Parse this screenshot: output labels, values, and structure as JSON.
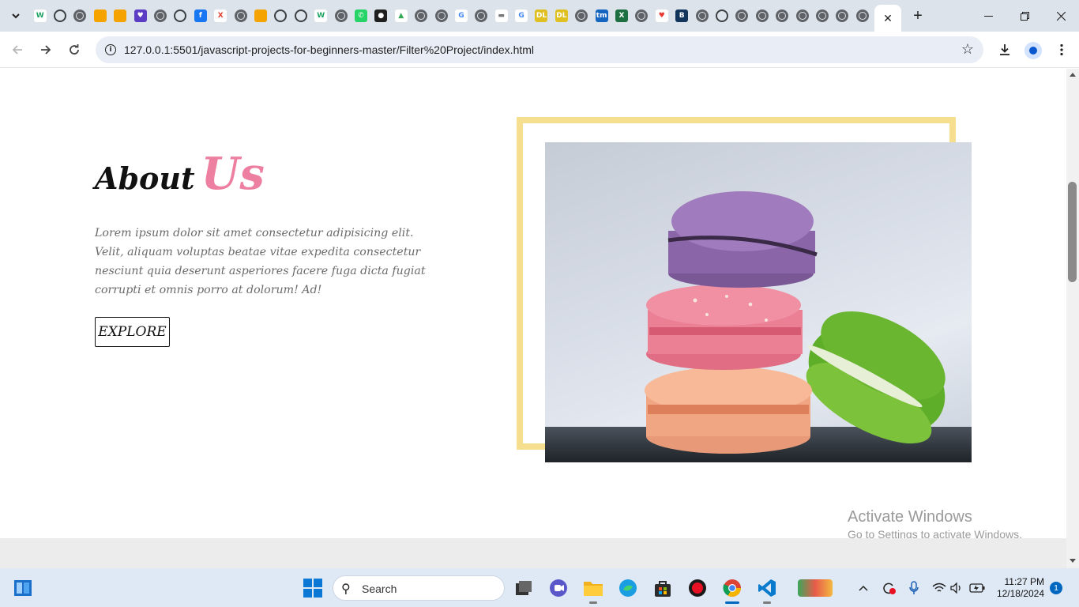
{
  "browser": {
    "active_tab_close": "✕",
    "new_tab": "+",
    "url": "127.0.0.1:5501/javascript-projects-for-beginners-master/Filter%20Project/index.html",
    "tab_favicons": [
      {
        "icon": "w-icon",
        "label": "W",
        "bg": "#ffffff",
        "fg": "#1aa260"
      },
      {
        "icon": "openai-icon",
        "label": "",
        "kind": "ring"
      },
      {
        "icon": "globe-icon",
        "label": "",
        "kind": "globe"
      },
      {
        "icon": "warning-icon",
        "label": "",
        "bg": "#f4a300"
      },
      {
        "icon": "warning-icon",
        "label": "",
        "bg": "#f4a300"
      },
      {
        "icon": "heart-badge-icon",
        "label": "♥",
        "bg": "#5b3cc4"
      },
      {
        "icon": "globe-icon",
        "label": "",
        "kind": "globe"
      },
      {
        "icon": "openai-icon",
        "label": "",
        "kind": "ring"
      },
      {
        "icon": "facebook-icon",
        "label": "f",
        "bg": "#1877f2"
      },
      {
        "icon": "x-icon",
        "label": "X",
        "bg": "#ffffff",
        "fg": "#e03e2d"
      },
      {
        "icon": "globe-icon",
        "label": "",
        "kind": "globe"
      },
      {
        "icon": "warning-icon",
        "label": "",
        "bg": "#f4a300"
      },
      {
        "icon": "openai-icon",
        "label": "",
        "kind": "ring"
      },
      {
        "icon": "chrome-icon",
        "label": "",
        "kind": "ring"
      },
      {
        "icon": "w-icon",
        "label": "W",
        "bg": "#ffffff",
        "fg": "#1aa260"
      },
      {
        "icon": "globe-icon",
        "label": "",
        "kind": "globe"
      },
      {
        "icon": "whatsapp-icon",
        "label": "✆",
        "bg": "#25d366"
      },
      {
        "icon": "github-icon",
        "label": "●",
        "bg": "#1f1f1f"
      },
      {
        "icon": "drive-icon",
        "label": "▲",
        "bg": "#ffffff",
        "fg": "#34a853"
      },
      {
        "icon": "globe-icon",
        "label": "",
        "kind": "globe"
      },
      {
        "icon": "globe-icon",
        "label": "",
        "kind": "globe"
      },
      {
        "icon": "google-icon",
        "label": "G",
        "bg": "#ffffff",
        "fg": "#4285f4"
      },
      {
        "icon": "globe-icon",
        "label": "",
        "kind": "globe"
      },
      {
        "icon": "page-icon",
        "label": "▬",
        "bg": "#ffffff",
        "fg": "#777777"
      },
      {
        "icon": "google-icon",
        "label": "G",
        "bg": "#ffffff",
        "fg": "#4285f4"
      },
      {
        "icon": "dxl-icon",
        "label": "DL",
        "bg": "#e0c020"
      },
      {
        "icon": "dxl-icon",
        "label": "DL",
        "bg": "#e0c020"
      },
      {
        "icon": "globe-icon",
        "label": "",
        "kind": "globe"
      },
      {
        "icon": "tm-icon",
        "label": "tm",
        "bg": "#1565c0"
      },
      {
        "icon": "excel-icon",
        "label": "X",
        "bg": "#1d6f42"
      },
      {
        "icon": "globe-icon",
        "label": "",
        "kind": "globe"
      },
      {
        "icon": "heart-icon",
        "label": "♥",
        "bg": "#ffffff",
        "fg": "#e53935"
      },
      {
        "icon": "bond-icon",
        "label": "B",
        "bg": "#12355b"
      },
      {
        "icon": "globe-icon",
        "label": "",
        "kind": "globe"
      },
      {
        "icon": "chrome-icon",
        "label": "",
        "kind": "ring"
      },
      {
        "icon": "globe-icon",
        "label": "",
        "kind": "globe"
      },
      {
        "icon": "globe-icon",
        "label": "",
        "kind": "globe"
      },
      {
        "icon": "globe-icon",
        "label": "",
        "kind": "globe"
      },
      {
        "icon": "globe-icon",
        "label": "",
        "kind": "globe"
      },
      {
        "icon": "globe-icon",
        "label": "",
        "kind": "globe"
      },
      {
        "icon": "globe-icon",
        "label": "",
        "kind": "globe"
      },
      {
        "icon": "globe-icon",
        "label": "",
        "kind": "globe"
      }
    ]
  },
  "page": {
    "about_title": "About",
    "about_title_accent": "Us",
    "about_text": "Lorem ipsum dolor sit amet consectetur adipisicing elit. Velit, aliquam voluptas beatae vitae expedita consectetur nesciunt quia deserunt asperiores facere fuga dicta fugiat corrupti et omnis porro at dolorum! Ad!",
    "explore_label": "EXPLORE",
    "accent_color": "#ed7fa0",
    "frame_color": "#f5de8e"
  },
  "watermark": {
    "line1": "Activate Windows",
    "line2": "Go to Settings to activate Windows."
  },
  "taskbar": {
    "search_label": "Search",
    "time": "11:27 PM",
    "date": "12/18/2024",
    "notification_count": "1"
  }
}
